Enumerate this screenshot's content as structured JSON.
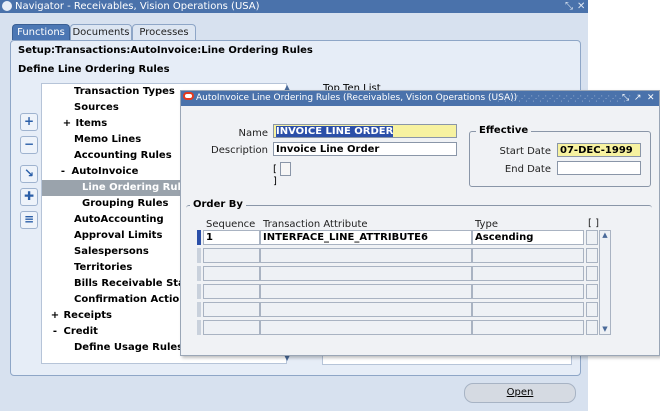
{
  "navigator": {
    "title": "Navigator - Receivables, Vision Operations (USA)",
    "tabs": [
      {
        "label": "Functions",
        "active": true
      },
      {
        "label": "Documents",
        "active": false
      },
      {
        "label": "Processes",
        "active": false
      }
    ],
    "path": "Setup:Transactions:AutoInvoice:Line Ordering Rules",
    "subtitle": "Define Line Ordering Rules",
    "tree_items": [
      {
        "label": "Transaction Types",
        "prefix": ""
      },
      {
        "label": "Sources",
        "prefix": ""
      },
      {
        "label": "Items",
        "prefix": "+"
      },
      {
        "label": "Memo Lines",
        "prefix": ""
      },
      {
        "label": "Accounting Rules",
        "prefix": ""
      },
      {
        "label": "AutoInvoice",
        "prefix": "-"
      },
      {
        "label": "Line Ordering Rules",
        "prefix": "",
        "selected": true
      },
      {
        "label": "Grouping Rules",
        "prefix": ""
      },
      {
        "label": "AutoAccounting",
        "prefix": ""
      },
      {
        "label": "Approval Limits",
        "prefix": ""
      },
      {
        "label": "Salespersons",
        "prefix": ""
      },
      {
        "label": "Territories",
        "prefix": ""
      },
      {
        "label": "Bills Receivable Stamp",
        "prefix": ""
      },
      {
        "label": "Confirmation Actions",
        "prefix": ""
      },
      {
        "label": "Receipts",
        "prefix": "+"
      },
      {
        "label": "Credit",
        "prefix": "-"
      },
      {
        "label": "Define Usage Rules",
        "prefix": ""
      }
    ],
    "top_list_label": "Top Ten List",
    "open_button": "Open",
    "side_buttons": [
      {
        "icon": "expand-icon",
        "glyph": "+"
      },
      {
        "icon": "collapse-icon",
        "glyph": "−"
      },
      {
        "icon": "expand-branch-icon",
        "glyph": "↘"
      },
      {
        "icon": "expand-all-icon",
        "glyph": "✚"
      },
      {
        "icon": "collapse-all-icon",
        "glyph": "≡"
      }
    ]
  },
  "dialog": {
    "title": "AutoInvoice Line Ordering Rules (Receivables, Vision Operations (USA))",
    "name_label": "Name",
    "name_value": "INVOICE LINE ORDER",
    "description_label": "Description",
    "description_value": "Invoice Line Order",
    "effective_title": "Effective",
    "start_date_label": "Start Date",
    "start_date_value": "07-DEC-1999",
    "end_date_label": "End Date",
    "end_date_value": "",
    "order_by_title": "Order By",
    "columns": [
      "Sequence",
      "Transaction Attribute",
      "Type"
    ],
    "rows": [
      {
        "sequence": "1",
        "attribute": "INTERFACE_LINE_ATTRIBUTE6",
        "type": "Ascending"
      }
    ]
  }
}
